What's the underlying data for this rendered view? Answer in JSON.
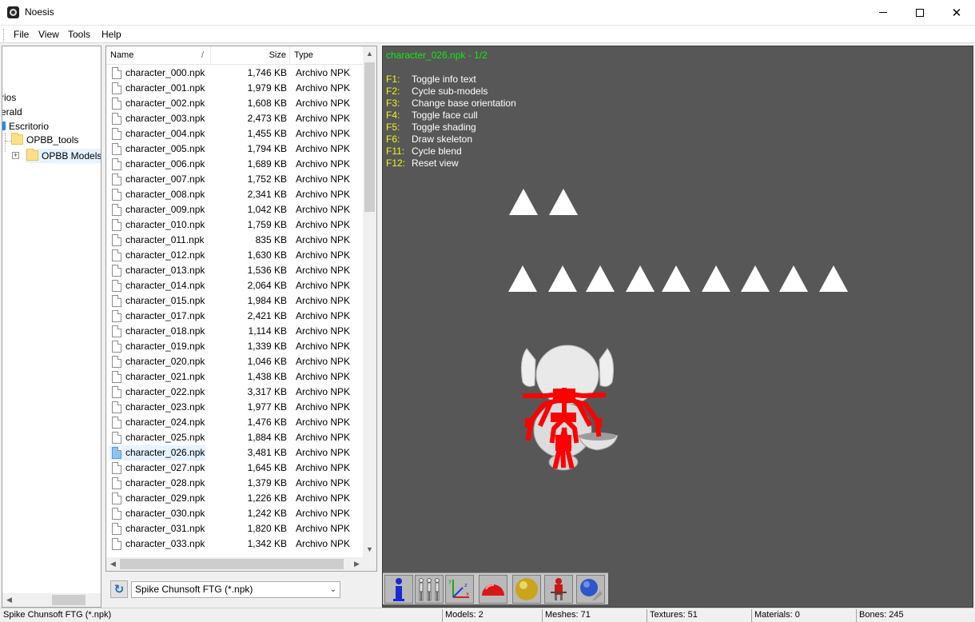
{
  "window": {
    "title": "Noesis",
    "minimize_glyph": "",
    "maximize_glyph": "",
    "close_glyph": "✕"
  },
  "menu": {
    "items": [
      "File",
      "View",
      "Tools",
      "Help"
    ]
  },
  "tree": {
    "nodes": [
      {
        "label": "rios"
      },
      {
        "label": "erald"
      },
      {
        "label": "Escritorio"
      },
      {
        "label": "OPBB_tools"
      },
      {
        "label": "OPBB Models"
      }
    ],
    "expander_glyph": "+"
  },
  "filelist": {
    "columns": {
      "name": "Name",
      "size": "Size",
      "type": "Type"
    },
    "sort_glyph": "/",
    "files": [
      {
        "name": "character_000.npk",
        "size": "1,746 KB",
        "type": "Archivo NPK"
      },
      {
        "name": "character_001.npk",
        "size": "1,979 KB",
        "type": "Archivo NPK"
      },
      {
        "name": "character_002.npk",
        "size": "1,608 KB",
        "type": "Archivo NPK"
      },
      {
        "name": "character_003.npk",
        "size": "2,473 KB",
        "type": "Archivo NPK"
      },
      {
        "name": "character_004.npk",
        "size": "1,455 KB",
        "type": "Archivo NPK"
      },
      {
        "name": "character_005.npk",
        "size": "1,794 KB",
        "type": "Archivo NPK"
      },
      {
        "name": "character_006.npk",
        "size": "1,689 KB",
        "type": "Archivo NPK"
      },
      {
        "name": "character_007.npk",
        "size": "1,752 KB",
        "type": "Archivo NPK"
      },
      {
        "name": "character_008.npk",
        "size": "2,341 KB",
        "type": "Archivo NPK"
      },
      {
        "name": "character_009.npk",
        "size": "1,042 KB",
        "type": "Archivo NPK"
      },
      {
        "name": "character_010.npk",
        "size": "1,759 KB",
        "type": "Archivo NPK"
      },
      {
        "name": "character_011.npk",
        "size": "835 KB",
        "type": "Archivo NPK"
      },
      {
        "name": "character_012.npk",
        "size": "1,630 KB",
        "type": "Archivo NPK"
      },
      {
        "name": "character_013.npk",
        "size": "1,536 KB",
        "type": "Archivo NPK"
      },
      {
        "name": "character_014.npk",
        "size": "2,064 KB",
        "type": "Archivo NPK"
      },
      {
        "name": "character_015.npk",
        "size": "1,984 KB",
        "type": "Archivo NPK"
      },
      {
        "name": "character_017.npk",
        "size": "2,421 KB",
        "type": "Archivo NPK"
      },
      {
        "name": "character_018.npk",
        "size": "1,114 KB",
        "type": "Archivo NPK"
      },
      {
        "name": "character_019.npk",
        "size": "1,339 KB",
        "type": "Archivo NPK"
      },
      {
        "name": "character_020.npk",
        "size": "1,046 KB",
        "type": "Archivo NPK"
      },
      {
        "name": "character_021.npk",
        "size": "1,438 KB",
        "type": "Archivo NPK"
      },
      {
        "name": "character_022.npk",
        "size": "3,317 KB",
        "type": "Archivo NPK"
      },
      {
        "name": "character_023.npk",
        "size": "1,977 KB",
        "type": "Archivo NPK"
      },
      {
        "name": "character_024.npk",
        "size": "1,476 KB",
        "type": "Archivo NPK"
      },
      {
        "name": "character_025.npk",
        "size": "1,884 KB",
        "type": "Archivo NPK"
      },
      {
        "name": "character_026.npk",
        "size": "3,481 KB",
        "type": "Archivo NPK",
        "selected": true
      },
      {
        "name": "character_027.npk",
        "size": "1,645 KB",
        "type": "Archivo NPK"
      },
      {
        "name": "character_028.npk",
        "size": "1,379 KB",
        "type": "Archivo NPK"
      },
      {
        "name": "character_029.npk",
        "size": "1,226 KB",
        "type": "Archivo NPK"
      },
      {
        "name": "character_030.npk",
        "size": "1,242 KB",
        "type": "Archivo NPK"
      },
      {
        "name": "character_031.npk",
        "size": "1,820 KB",
        "type": "Archivo NPK"
      },
      {
        "name": "character_033.npk",
        "size": "1,342 KB",
        "type": "Archivo NPK"
      }
    ],
    "scroll_up": "▲",
    "scroll_down": "▼",
    "scroll_left": "◀",
    "scroll_right": "▶",
    "tree_scroll_left": "◀"
  },
  "format": {
    "refresh_glyph": "↻",
    "selected": "Spike Chunsoft FTG (*.npk)",
    "chevron": "⌄"
  },
  "viewport": {
    "title": "character_026.npk - 1/2",
    "title_color": "#12e812",
    "key_color": "#f2f21c",
    "help": [
      {
        "key": "F1:",
        "desc": "Toggle info text"
      },
      {
        "key": "F2:",
        "desc": "Cycle sub-models"
      },
      {
        "key": "F3:",
        "desc": "Change base orientation"
      },
      {
        "key": "F4:",
        "desc": "Toggle face cull"
      },
      {
        "key": "F5:",
        "desc": "Toggle shading"
      },
      {
        "key": "F6:",
        "desc": "Draw skeleton"
      },
      {
        "key": "F11:",
        "desc": "Cycle blend"
      },
      {
        "key": "F12:",
        "desc": "Reset view"
      }
    ],
    "toolbar_icons": [
      "info-icon",
      "skeletons-icon",
      "axes-icon",
      "hemisphere-icon",
      "sphere-icon",
      "figure-icon",
      "globe-tools-icon"
    ],
    "skeleton_color": "#ff0000"
  },
  "statusbar": {
    "format": "Spike Chunsoft FTG (*.npk)",
    "models": "Models: 2",
    "meshes": "Meshes: 71",
    "textures": "Textures: 51",
    "materials": "Materials: 0",
    "bones": "Bones: 245"
  }
}
